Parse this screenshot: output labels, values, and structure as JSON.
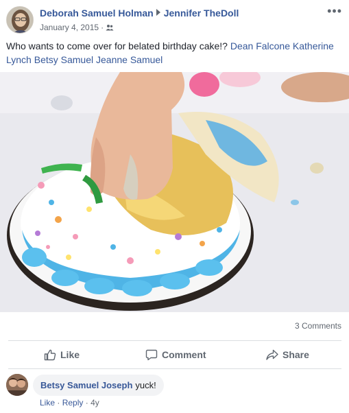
{
  "post": {
    "author": "Deborah Samuel Holman",
    "recipient": "Jennifer TheDoll",
    "date": "January 4, 2015",
    "audience_icon": "friends-icon",
    "more_icon": "more-options-icon",
    "text": "Who wants to come over for belated birthday cake!?",
    "tags": [
      "Dean Falcone",
      "Katherine Lynch",
      "Betsy Samuel",
      "Jeanne Samuel"
    ],
    "photo_icon": "cake-smash-photo"
  },
  "stats": {
    "comments": "3 Comments"
  },
  "actions": {
    "like": "Like",
    "comment": "Comment",
    "share": "Share"
  },
  "comment": {
    "author": "Betsy Samuel Joseph",
    "text": "yuck!",
    "like": "Like",
    "reply": "Reply",
    "age": "4y"
  },
  "colors": {
    "link": "#365899",
    "muted": "#606770",
    "divider": "#dadde1",
    "bubble": "#f2f3f5"
  }
}
